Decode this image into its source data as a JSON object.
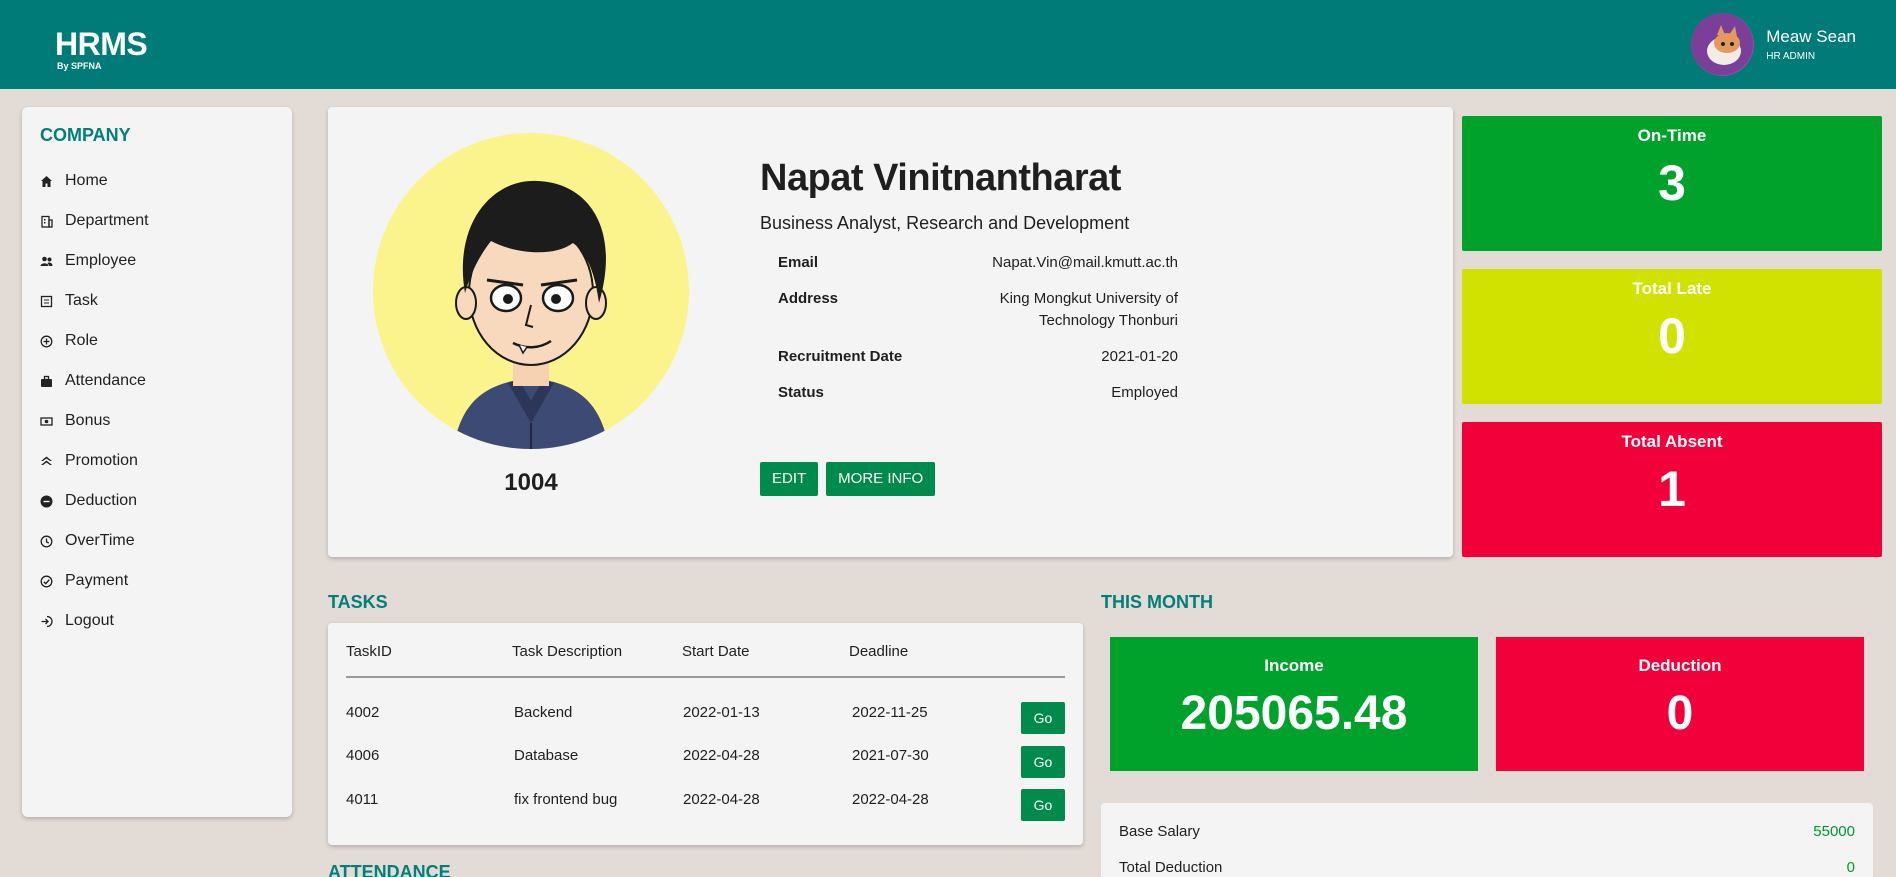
{
  "header": {
    "logo": "HRMS",
    "logo_sub": "By SPFNA",
    "user_name": "Meaw Sean",
    "user_role": "HR ADMIN"
  },
  "sidebar": {
    "heading": "COMPANY",
    "items": [
      {
        "label": "Home",
        "icon": "home-icon"
      },
      {
        "label": "Department",
        "icon": "building-icon"
      },
      {
        "label": "Employee",
        "icon": "people-icon"
      },
      {
        "label": "Task",
        "icon": "task-icon"
      },
      {
        "label": "Role",
        "icon": "role-icon"
      },
      {
        "label": "Attendance",
        "icon": "briefcase-icon"
      },
      {
        "label": "Bonus",
        "icon": "money-icon"
      },
      {
        "label": "Promotion",
        "icon": "promotion-icon"
      },
      {
        "label": "Deduction",
        "icon": "minus-circle-icon"
      },
      {
        "label": "OverTime",
        "icon": "clock-icon"
      },
      {
        "label": "Payment",
        "icon": "check-circle-icon"
      },
      {
        "label": "Logout",
        "icon": "logout-icon"
      }
    ]
  },
  "profile": {
    "id": "1004",
    "name": "Napat Vinitnantharat",
    "title": "Business Analyst, Research and Development",
    "fields": [
      {
        "label": "Email",
        "value": "Napat.Vin@mail.kmutt.ac.th"
      },
      {
        "label": "Address",
        "value": "King Mongkut University of Technology Thonburi"
      },
      {
        "label": "Recruitment Date",
        "value": "2021-01-20"
      },
      {
        "label": "Status",
        "value": "Employed"
      }
    ],
    "edit_label": "EDIT",
    "more_label": "MORE INFO"
  },
  "stats": {
    "ontime": {
      "label": "On-Time",
      "value": "3",
      "color": "#00a22c"
    },
    "late": {
      "label": "Total Late",
      "value": "0",
      "color": "#d1e200"
    },
    "absent": {
      "label": "Total Absent",
      "value": "1",
      "color": "#f2003a"
    }
  },
  "tasks": {
    "title": "TASKS",
    "headers": [
      "TaskID",
      "Task Description",
      "Start Date",
      "Deadline"
    ],
    "rows": [
      {
        "id": "4002",
        "desc": "Backend",
        "start": "2022-01-13",
        "deadline": "2022-11-25",
        "action": "Go"
      },
      {
        "id": "4006",
        "desc": "Database",
        "start": "2022-04-28",
        "deadline": "2021-07-30",
        "action": "Go"
      },
      {
        "id": "4011",
        "desc": "fix frontend bug",
        "start": "2022-04-28",
        "deadline": "2022-04-28",
        "action": "Go"
      }
    ]
  },
  "attendance_title": "ATTENDANCE",
  "month": {
    "title": "THIS MONTH",
    "income_label": "Income",
    "income_value": "205065.48",
    "deduction_label": "Deduction",
    "deduction_value": "0",
    "base_salary_label": "Base Salary",
    "base_salary_value": "55000",
    "total_deduction_label": "Total Deduction",
    "total_deduction_value": "0"
  }
}
